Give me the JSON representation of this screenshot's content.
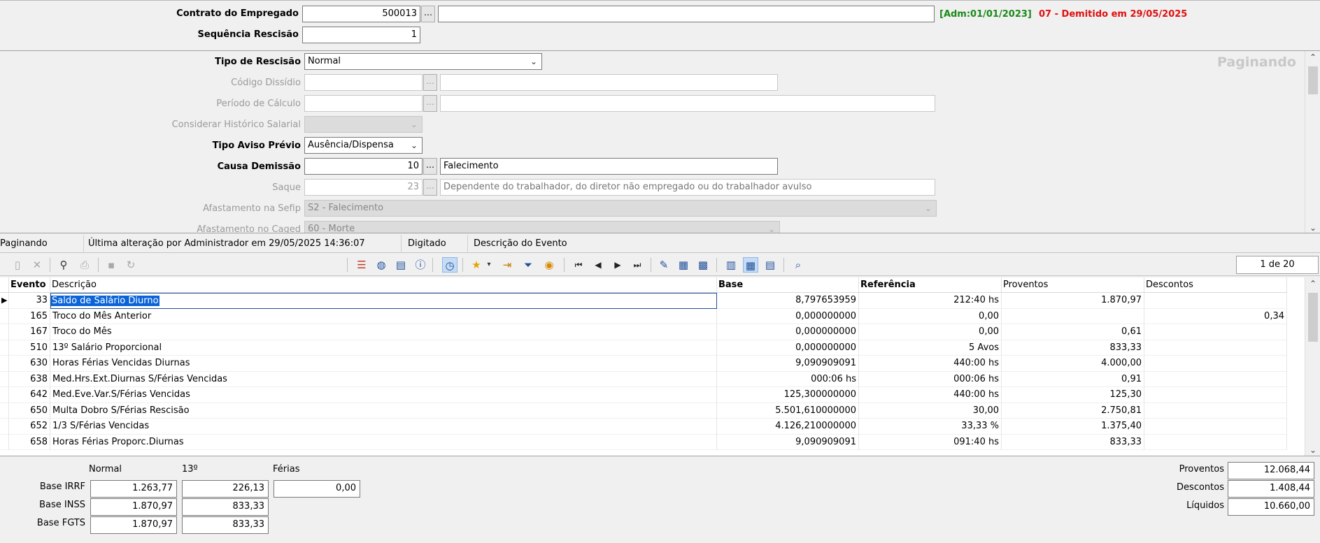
{
  "contract": {
    "label": "Contrato do Empregado",
    "value": "500013",
    "name_value": "",
    "status_admission": "[Adm:01/01/2023]",
    "status_dismissal": "07 - Demitido em 29/05/2025",
    "colors": {
      "admission": "#1a8a1a",
      "dismissal": "#e01010"
    }
  },
  "sequence": {
    "label": "Sequência Rescisão",
    "value": "1"
  },
  "form": {
    "paginando_label": "Paginando",
    "tipo_rescisao": {
      "label": "Tipo de Rescisão",
      "value": "Normal"
    },
    "codigo_dissidio": {
      "label": "Código Dissídio",
      "value": "",
      "desc": ""
    },
    "periodo_calculo": {
      "label": "Período de Cálculo",
      "value": "",
      "desc": ""
    },
    "considerar_historico": {
      "label": "Considerar Histórico Salarial",
      "value": ""
    },
    "tipo_aviso_previo": {
      "label": "Tipo Aviso Prévio",
      "value": "Ausência/Dispensa"
    },
    "causa_demissao": {
      "label": "Causa Demissão",
      "value": "10",
      "desc": "Falecimento"
    },
    "saque": {
      "label": "Saque",
      "value": "23",
      "desc": "Dependente do trabalhador, do diretor não empregado ou do trabalhador avulso"
    },
    "afastamento_sefip": {
      "label": "Afastamento na Sefip",
      "value": "S2 - Falecimento"
    },
    "afastamento_caged": {
      "label": "Afastamento no Caged",
      "value": "60 - Morte"
    }
  },
  "status_bar": {
    "mode": "Paginando",
    "last_change": "Última alteração por Administrador em 29/05/2025 14:36:07",
    "state": "Digitado",
    "field_desc": "Descrição do Evento"
  },
  "toolbar": {
    "page_counter": "1 de 20"
  },
  "grid": {
    "columns": [
      "Evento",
      "Descrição",
      "Base",
      "Referência",
      "Proventos",
      "Descontos"
    ],
    "rows": [
      {
        "evento": "33",
        "descricao": "Saldo de Salário Diurno",
        "base": "8,797653959",
        "referencia": "212:40 hs",
        "proventos": "1.870,97",
        "descontos": ""
      },
      {
        "evento": "165",
        "descricao": "Troco do Mês Anterior",
        "base": "0,000000000",
        "referencia": "0,00",
        "proventos": "",
        "descontos": "0,34"
      },
      {
        "evento": "167",
        "descricao": "Troco do Mês",
        "base": "0,000000000",
        "referencia": "0,00",
        "proventos": "0,61",
        "descontos": ""
      },
      {
        "evento": "510",
        "descricao": "13º Salário Proporcional",
        "base": "0,000000000",
        "referencia": "5 Avos",
        "proventos": "833,33",
        "descontos": ""
      },
      {
        "evento": "630",
        "descricao": "Horas Férias Vencidas Diurnas",
        "base": "9,090909091",
        "referencia": "440:00 hs",
        "proventos": "4.000,00",
        "descontos": ""
      },
      {
        "evento": "638",
        "descricao": "Med.Hrs.Ext.Diurnas S/Férias Vencidas",
        "base": "000:06 hs",
        "referencia": "000:06 hs",
        "proventos": "0,91",
        "descontos": ""
      },
      {
        "evento": "642",
        "descricao": "Med.Eve.Var.S/Férias Vencidas",
        "base": "125,300000000",
        "referencia": "440:00 hs",
        "proventos": "125,30",
        "descontos": ""
      },
      {
        "evento": "650",
        "descricao": "Multa Dobro S/Férias Rescisão",
        "base": "5.501,610000000",
        "referencia": "30,00",
        "proventos": "2.750,81",
        "descontos": ""
      },
      {
        "evento": "652",
        "descricao": "1/3 S/Férias Vencidas",
        "base": "4.126,210000000",
        "referencia": "33,33 %",
        "proventos": "1.375,40",
        "descontos": ""
      },
      {
        "evento": "658",
        "descricao": "Horas Férias Proporc.Diurnas",
        "base": "9,090909091",
        "referencia": "091:40 hs",
        "proventos": "833,33",
        "descontos": ""
      }
    ]
  },
  "totals": {
    "col_headers": {
      "normal": "Normal",
      "decimo": "13º",
      "ferias": "Férias"
    },
    "base_irrf": {
      "label": "Base IRRF",
      "normal": "1.263,77",
      "decimo": "226,13",
      "ferias": "0,00"
    },
    "base_inss": {
      "label": "Base INSS",
      "normal": "1.870,97",
      "decimo": "833,33"
    },
    "base_fgts": {
      "label": "Base FGTS",
      "normal": "1.870,97",
      "decimo": "833,33"
    },
    "proventos": {
      "label": "Proventos",
      "value": "12.068,44"
    },
    "descontos": {
      "label": "Descontos",
      "value": "1.408,44"
    },
    "liquidos": {
      "label": "Líquidos",
      "value": "10.660,00"
    }
  }
}
